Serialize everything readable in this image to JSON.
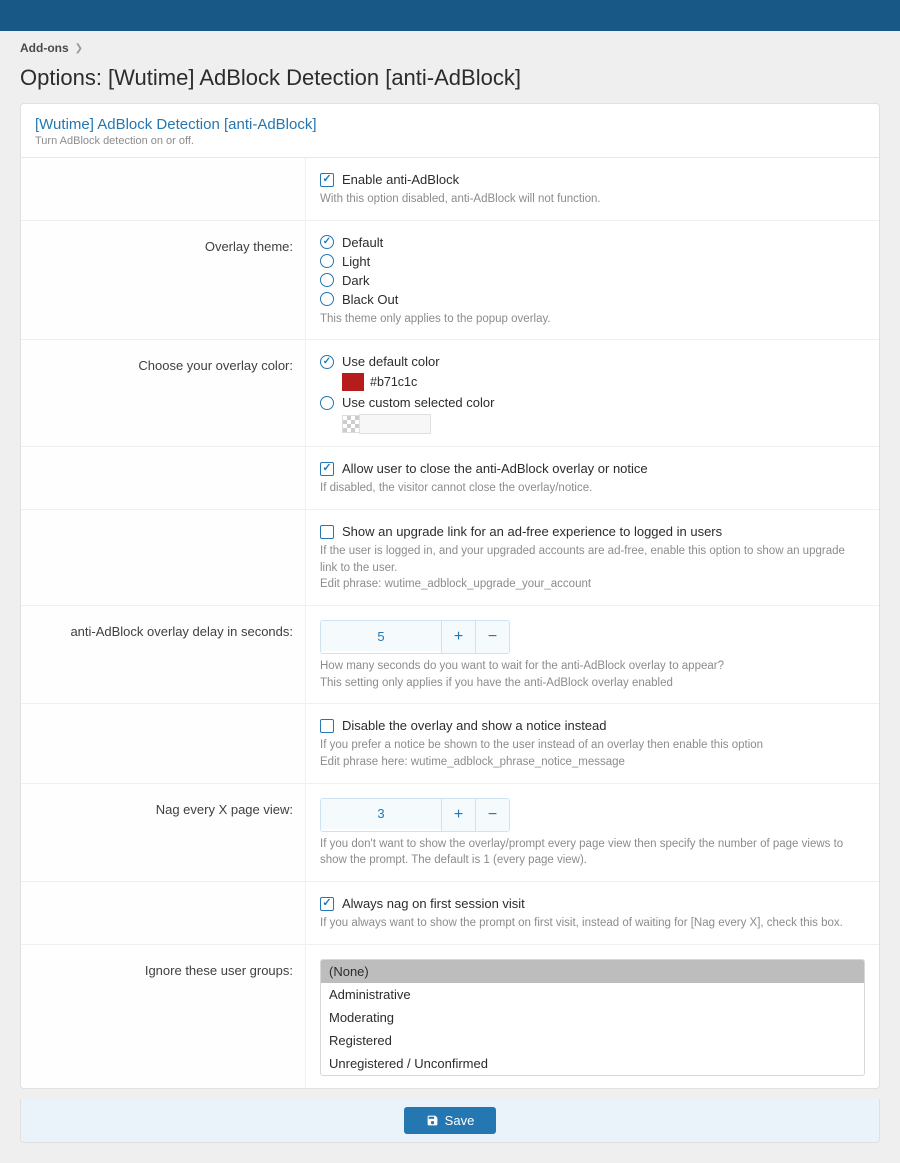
{
  "breadcrumb": {
    "item": "Add-ons"
  },
  "page_title": "Options: [Wutime] AdBlock Detection [anti-AdBlock]",
  "header": {
    "title": "[Wutime] AdBlock Detection [anti-AdBlock]",
    "sub": "Turn AdBlock detection on or off."
  },
  "enable": {
    "label": "Enable anti-AdBlock",
    "hint": "With this option disabled, anti-AdBlock will not function."
  },
  "overlay_theme": {
    "label": "Overlay theme:",
    "options": {
      "default": "Default",
      "light": "Light",
      "dark": "Dark",
      "blackout": "Black Out"
    },
    "hint": "This theme only applies to the popup overlay."
  },
  "overlay_color": {
    "label": "Choose your overlay color:",
    "use_default": "Use default color",
    "default_hex": "#b71c1c",
    "use_custom": "Use custom selected color"
  },
  "allow_close": {
    "label": "Allow user to close the anti-AdBlock overlay or notice",
    "hint": "If disabled, the visitor cannot close the overlay/notice."
  },
  "upgrade_link": {
    "label": "Show an upgrade link for an ad-free experience to logged in users",
    "hint": "If the user is logged in, and your upgraded accounts are ad-free, enable this option to show an upgrade link to the user.\nEdit phrase: wutime_adblock_upgrade_your_account"
  },
  "delay": {
    "label": "anti-AdBlock overlay delay in seconds:",
    "value": "5",
    "hint": "How many seconds do you want to wait for the anti-AdBlock overlay to appear?\nThis setting only applies if you have the anti-AdBlock overlay enabled"
  },
  "disable_overlay": {
    "label": "Disable the overlay and show a notice instead",
    "hint": "If you prefer a notice be shown to the user instead of an overlay then enable this option\nEdit phrase here: wutime_adblock_phrase_notice_message"
  },
  "nag": {
    "label": "Nag every X page view:",
    "value": "3",
    "hint": "If you don't want to show the overlay/prompt every page view then specify the number of page views to show the prompt. The default is 1 (every page view)."
  },
  "always_nag": {
    "label": "Always nag on first session visit",
    "hint": "If you always want to show the prompt on first visit, instead of waiting for [Nag every X], check this box."
  },
  "ignore_groups": {
    "label": "Ignore these user groups:",
    "options": [
      "(None)",
      "Administrative",
      "Moderating",
      "Registered",
      "Unregistered / Unconfirmed"
    ]
  },
  "save_label": "Save"
}
